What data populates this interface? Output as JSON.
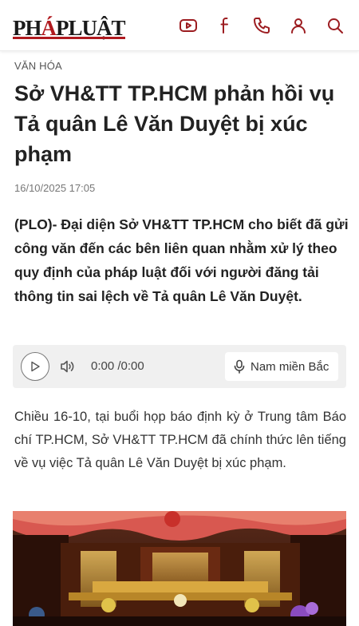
{
  "header": {
    "logo_text_1": "PH",
    "logo_text_accent": "Á",
    "logo_text_2": "PLUẬT",
    "icons": [
      "youtube-icon",
      "facebook-icon",
      "phone-icon",
      "user-icon",
      "search-icon"
    ]
  },
  "article": {
    "category": "VĂN HÓA",
    "title": "Sở VH&TT TP.HCM phản hồi vụ Tả quân Lê Văn Duyệt bị xúc phạm",
    "timestamp": "16/10/2025 17:05",
    "sapo": "(PLO)- Đại diện Sở VH&TT TP.HCM cho biết đã gửi công văn đến các bên liên quan nhằm xử lý theo quy định của pháp luật đối với người đăng tải thông tin sai lệch về Tả quân Lê Văn Duyệt.",
    "body": "Chiều 16-10, tại buổi họp báo định kỳ ở Trung tâm Báo chí TP.HCM, Sở VH&TT TP.HCM đã chính thức lên tiếng về vụ việc Tả quân Lê Văn Duyệt bị xúc phạm."
  },
  "audio": {
    "time": "0:00 /0:00",
    "voice": "Nam miền Bắc"
  },
  "colors": {
    "brand": "#9c1c20",
    "logo_red": "#b01a1f",
    "player_bg": "#f0f0f0"
  }
}
